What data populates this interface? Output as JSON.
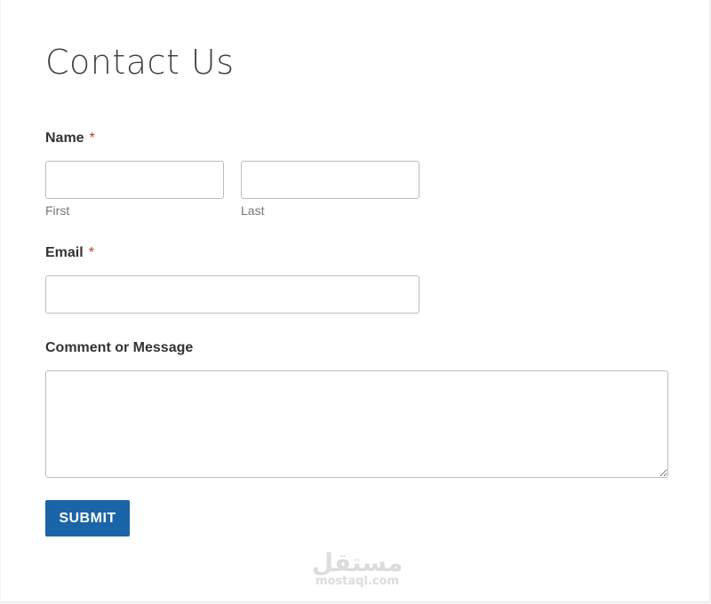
{
  "form": {
    "title": "Contact Us",
    "name_label": "Name",
    "required_mark": "*",
    "first_value": "",
    "first_sublabel": "First",
    "last_value": "",
    "last_sublabel": "Last",
    "email_label": "Email",
    "email_value": "",
    "message_label": "Comment or Message",
    "message_value": "",
    "submit_label": "SUBMIT"
  },
  "watermark": {
    "arabic": "مستقل",
    "latin": "mostaql.com"
  },
  "colors": {
    "accent": "#1a64a8",
    "required": "#c0392b",
    "border": "#bdbdbd"
  }
}
